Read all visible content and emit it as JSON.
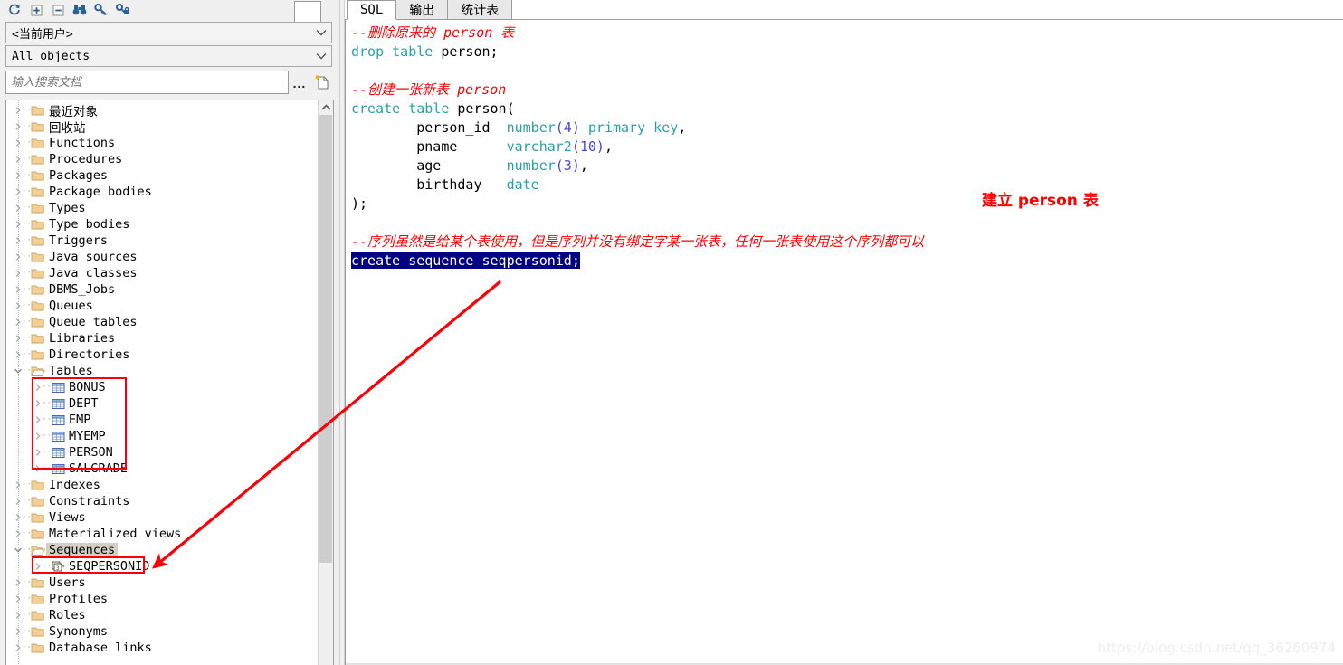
{
  "browser_toolbar": {
    "buttons": [
      {
        "name": "refresh-icon",
        "title": "Refresh"
      },
      {
        "name": "expand-all-icon",
        "title": "Expand"
      },
      {
        "name": "collapse-all-icon",
        "title": "Collapse"
      },
      {
        "name": "find-icon",
        "title": "Find"
      },
      {
        "name": "key-icon",
        "title": "Key"
      },
      {
        "name": "key-lock-icon",
        "title": "Key lock"
      }
    ]
  },
  "filters": {
    "user_combo_value": "<当前用户>",
    "object_combo_value": "All objects"
  },
  "search": {
    "placeholder": "输入搜索文档",
    "value": "",
    "ellipsis_label": "...",
    "new_doc_icon": "new-document-icon"
  },
  "tree": {
    "nodes": [
      {
        "label": "最近对象",
        "icon": "folder-icon",
        "level": 1,
        "expanded": false
      },
      {
        "label": "回收站",
        "icon": "folder-icon",
        "level": 1,
        "expanded": false
      },
      {
        "label": "Functions",
        "icon": "folder-icon",
        "level": 1,
        "expanded": false
      },
      {
        "label": "Procedures",
        "icon": "folder-icon",
        "level": 1,
        "expanded": false
      },
      {
        "label": "Packages",
        "icon": "folder-icon",
        "level": 1,
        "expanded": false
      },
      {
        "label": "Package bodies",
        "icon": "folder-icon",
        "level": 1,
        "expanded": false
      },
      {
        "label": "Types",
        "icon": "folder-icon",
        "level": 1,
        "expanded": false
      },
      {
        "label": "Type bodies",
        "icon": "folder-icon",
        "level": 1,
        "expanded": false
      },
      {
        "label": "Triggers",
        "icon": "folder-icon",
        "level": 1,
        "expanded": false
      },
      {
        "label": "Java sources",
        "icon": "folder-icon",
        "level": 1,
        "expanded": false
      },
      {
        "label": "Java classes",
        "icon": "folder-icon",
        "level": 1,
        "expanded": false
      },
      {
        "label": "DBMS_Jobs",
        "icon": "folder-icon",
        "level": 1,
        "expanded": false
      },
      {
        "label": "Queues",
        "icon": "folder-icon",
        "level": 1,
        "expanded": false
      },
      {
        "label": "Queue tables",
        "icon": "folder-icon",
        "level": 1,
        "expanded": false
      },
      {
        "label": "Libraries",
        "icon": "folder-icon",
        "level": 1,
        "expanded": false
      },
      {
        "label": "Directories",
        "icon": "folder-icon",
        "level": 1,
        "expanded": false
      },
      {
        "label": "Tables",
        "icon": "folder-open-icon",
        "level": 1,
        "expanded": true
      },
      {
        "label": "BONUS",
        "icon": "table-icon",
        "level": 2,
        "expanded": false
      },
      {
        "label": "DEPT",
        "icon": "table-icon",
        "level": 2,
        "expanded": false
      },
      {
        "label": "EMP",
        "icon": "table-icon",
        "level": 2,
        "expanded": false
      },
      {
        "label": "MYEMP",
        "icon": "table-icon",
        "level": 2,
        "expanded": false
      },
      {
        "label": "PERSON",
        "icon": "table-icon",
        "level": 2,
        "expanded": false
      },
      {
        "label": "SALGRADE",
        "icon": "table-icon",
        "level": 2,
        "expanded": false
      },
      {
        "label": "Indexes",
        "icon": "folder-icon",
        "level": 1,
        "expanded": false
      },
      {
        "label": "Constraints",
        "icon": "folder-icon",
        "level": 1,
        "expanded": false
      },
      {
        "label": "Views",
        "icon": "folder-icon",
        "level": 1,
        "expanded": false
      },
      {
        "label": "Materialized views",
        "icon": "folder-icon",
        "level": 1,
        "expanded": false
      },
      {
        "label": "Sequences",
        "icon": "folder-open-icon",
        "level": 1,
        "expanded": true,
        "selected": true
      },
      {
        "label": "SEQPERSONID",
        "icon": "sequence-icon",
        "level": 2,
        "expanded": false
      },
      {
        "label": "Users",
        "icon": "folder-icon",
        "level": 1,
        "expanded": false
      },
      {
        "label": "Profiles",
        "icon": "folder-icon",
        "level": 1,
        "expanded": false
      },
      {
        "label": "Roles",
        "icon": "folder-icon",
        "level": 1,
        "expanded": false
      },
      {
        "label": "Synonyms",
        "icon": "folder-icon",
        "level": 1,
        "expanded": false
      },
      {
        "label": "Database links",
        "icon": "folder-icon",
        "level": 1,
        "expanded": false
      }
    ]
  },
  "editor": {
    "tabs": [
      {
        "label": "SQL",
        "active": true
      },
      {
        "label": "输出",
        "active": false
      },
      {
        "label": "统计表",
        "active": false
      }
    ],
    "code_lines": [
      {
        "segments": [
          {
            "t": "--删除原来的 person 表",
            "c": "cmt"
          }
        ]
      },
      {
        "segments": [
          {
            "t": "drop table ",
            "c": "kw"
          },
          {
            "t": "person;",
            "c": "id"
          }
        ]
      },
      {
        "segments": [
          {
            "t": "",
            "c": "id"
          }
        ]
      },
      {
        "segments": [
          {
            "t": "--创建一张新表 person",
            "c": "cmt"
          }
        ]
      },
      {
        "segments": [
          {
            "t": "create table ",
            "c": "kw"
          },
          {
            "t": "person(",
            "c": "id"
          }
        ]
      },
      {
        "segments": [
          {
            "t": "        person_id  ",
            "c": "id"
          },
          {
            "t": "number",
            "c": "kw"
          },
          {
            "t": "(4)",
            "c": "num"
          },
          {
            "t": " ",
            "c": "id"
          },
          {
            "t": "primary key",
            "c": "kw"
          },
          {
            "t": ",",
            "c": "id"
          }
        ]
      },
      {
        "segments": [
          {
            "t": "        pname      ",
            "c": "id"
          },
          {
            "t": "varchar2",
            "c": "kw"
          },
          {
            "t": "(10)",
            "c": "num"
          },
          {
            "t": ",",
            "c": "id"
          }
        ]
      },
      {
        "segments": [
          {
            "t": "        age        ",
            "c": "id"
          },
          {
            "t": "number",
            "c": "kw"
          },
          {
            "t": "(3)",
            "c": "num"
          },
          {
            "t": ",",
            "c": "id"
          }
        ]
      },
      {
        "segments": [
          {
            "t": "        birthday   ",
            "c": "id"
          },
          {
            "t": "date",
            "c": "kw"
          }
        ]
      },
      {
        "segments": [
          {
            "t": ");",
            "c": "id"
          }
        ]
      },
      {
        "segments": [
          {
            "t": "",
            "c": "id"
          }
        ]
      },
      {
        "segments": [
          {
            "t": "--序列虽然是给某个表使用，但是序列并没有绑定字某一张表，任何一张表使用这个序列都可以",
            "c": "cmt"
          }
        ]
      },
      {
        "segments": [
          {
            "t": "create sequence seqpersonid;",
            "c": "hl"
          }
        ]
      }
    ],
    "annotation": "建立 person 表",
    "watermark": "https://blog.csdn.net/qq_36260974"
  },
  "colors": {
    "annotation_red": "#ff0000",
    "keyword_teal": "#2aa0a8",
    "number_blue": "#4545e0",
    "selection_navy": "#000080",
    "highlight_box": "#fb0007"
  }
}
